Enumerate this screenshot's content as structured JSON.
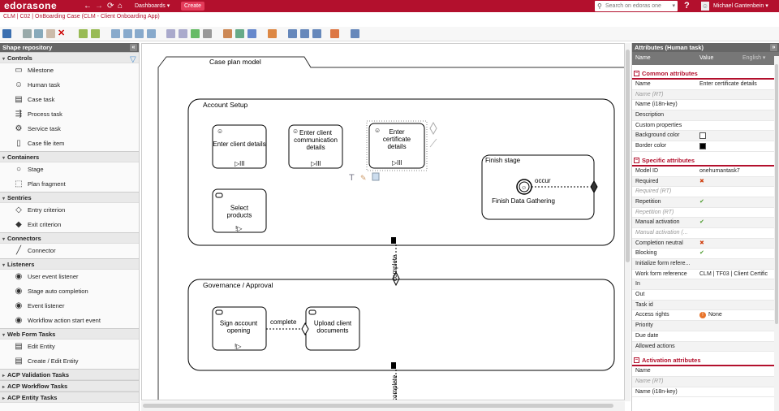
{
  "topbar": {
    "logo": "edorasone",
    "nav_back": "←",
    "nav_fwd": "→",
    "nav_refresh": "⟳",
    "nav_home": "⌂",
    "dashboards": "Dashboards ▾",
    "create": "Create",
    "search_placeholder": "Search on edoras one",
    "search_dd": "▾",
    "help": "?",
    "user": "Michael Gantenbein ▾"
  },
  "breadcrumb": "CLM | C02 | OnBoarding Case  (CLM - Client Onboarding App)",
  "repo": {
    "title": "Shape repository",
    "collapse": "«",
    "sections": [
      {
        "label": "Controls",
        "items": [
          {
            "label": "Milestone",
            "icon": "▭"
          },
          {
            "label": "Human task",
            "icon": "☺"
          },
          {
            "label": "Case task",
            "icon": "▤"
          },
          {
            "label": "Process task",
            "icon": "⇶"
          },
          {
            "label": "Service task",
            "icon": "⚙"
          },
          {
            "label": "Case file item",
            "icon": "▯"
          }
        ]
      },
      {
        "label": "Containers",
        "items": [
          {
            "label": "Stage",
            "icon": "○"
          },
          {
            "label": "Plan fragment",
            "icon": "⬚"
          }
        ]
      },
      {
        "label": "Sentries",
        "items": [
          {
            "label": "Entry criterion",
            "icon": "◇"
          },
          {
            "label": "Exit criterion",
            "icon": "◆"
          }
        ]
      },
      {
        "label": "Connectors",
        "items": [
          {
            "label": "Connector",
            "icon": "╱"
          }
        ]
      },
      {
        "label": "Listeners",
        "items": [
          {
            "label": "User event listener",
            "icon": "◉"
          },
          {
            "label": "Stage auto completion",
            "icon": "◉"
          },
          {
            "label": "Event listener",
            "icon": "◉"
          },
          {
            "label": "Workflow action start event",
            "icon": "◉"
          }
        ]
      },
      {
        "label": "Web Form Tasks",
        "items": [
          {
            "label": "Edit Entity",
            "icon": "▤"
          },
          {
            "label": "Create / Edit Entity",
            "icon": "▤"
          }
        ]
      },
      {
        "label": "ACP Validation Tasks",
        "items": []
      },
      {
        "label": "ACP Workflow Tasks",
        "items": []
      },
      {
        "label": "ACP Entity Tasks",
        "items": []
      }
    ]
  },
  "canvas": {
    "case_plan_tab": "Case plan model",
    "stage1": "Account Setup",
    "stage2": "Governance / Approval",
    "finish_stage": "Finish stage",
    "tasks": {
      "enter_client_details": "Enter client details",
      "enter_comm_details": "Enter client communication details",
      "enter_cert_details": "Enter certificate details",
      "select_products": "Select products",
      "sign_account": "Sign account opening",
      "upload_docs": "Upload client documents"
    },
    "milestone": "Finish Data Gathering",
    "occur": "occur",
    "complete1": "complete",
    "complete2": "complete",
    "complete3": "complete"
  },
  "attributes": {
    "title": "Attributes (Human task)",
    "collapse": "»",
    "col_name": "Name",
    "col_value": "Value",
    "lang": "English ▾",
    "sections": [
      {
        "label": "Common attributes",
        "rows": [
          {
            "name": "Name",
            "value": "Enter certificate details"
          },
          {
            "name": "Name (RT)",
            "value": "",
            "ro": true
          },
          {
            "name": "Name (i18n-key)",
            "value": ""
          },
          {
            "name": "Description",
            "value": ""
          },
          {
            "name": "Custom properties",
            "value": ""
          },
          {
            "name": "Background color",
            "value": "",
            "swatch": "#ffffff"
          },
          {
            "name": "Border color",
            "value": "",
            "swatch": "#000000"
          }
        ]
      },
      {
        "label": "Specific attributes",
        "rows": [
          {
            "name": "Model ID",
            "value": "onehumantask7"
          },
          {
            "name": "Required",
            "value": "✖",
            "status": "no"
          },
          {
            "name": "Required (RT)",
            "value": "",
            "ro": true
          },
          {
            "name": "Repetition",
            "value": "✔",
            "status": "yes"
          },
          {
            "name": "Repetition (RT)",
            "value": "",
            "ro": true
          },
          {
            "name": "Manual activation",
            "value": "✔",
            "status": "yes"
          },
          {
            "name": "Manual activation (...",
            "value": "",
            "ro": true
          },
          {
            "name": "Completion neutral",
            "value": "✖",
            "status": "no"
          },
          {
            "name": "Blocking",
            "value": "✔",
            "status": "yes"
          },
          {
            "name": "Initialize form refere...",
            "value": ""
          },
          {
            "name": "Work form reference",
            "value": "CLM | TF03 | Client Certific"
          },
          {
            "name": "In",
            "value": ""
          },
          {
            "name": "Out",
            "value": ""
          },
          {
            "name": "Task id",
            "value": ""
          },
          {
            "name": "Access rights",
            "value": "None",
            "warn": "!"
          },
          {
            "name": "Priority",
            "value": ""
          },
          {
            "name": "Due date",
            "value": ""
          },
          {
            "name": "Allowed actions",
            "value": ""
          }
        ]
      },
      {
        "label": "Activation attributes",
        "rows": [
          {
            "name": "Name",
            "value": ""
          },
          {
            "name": "Name (RT)",
            "value": "",
            "ro": true
          },
          {
            "name": "Name (i18n-key)",
            "value": ""
          }
        ]
      }
    ]
  },
  "colors": {
    "brand": "#b3102d",
    "ok": "#4a9a2a",
    "err": "#d04010",
    "warn": "#e8742a"
  }
}
